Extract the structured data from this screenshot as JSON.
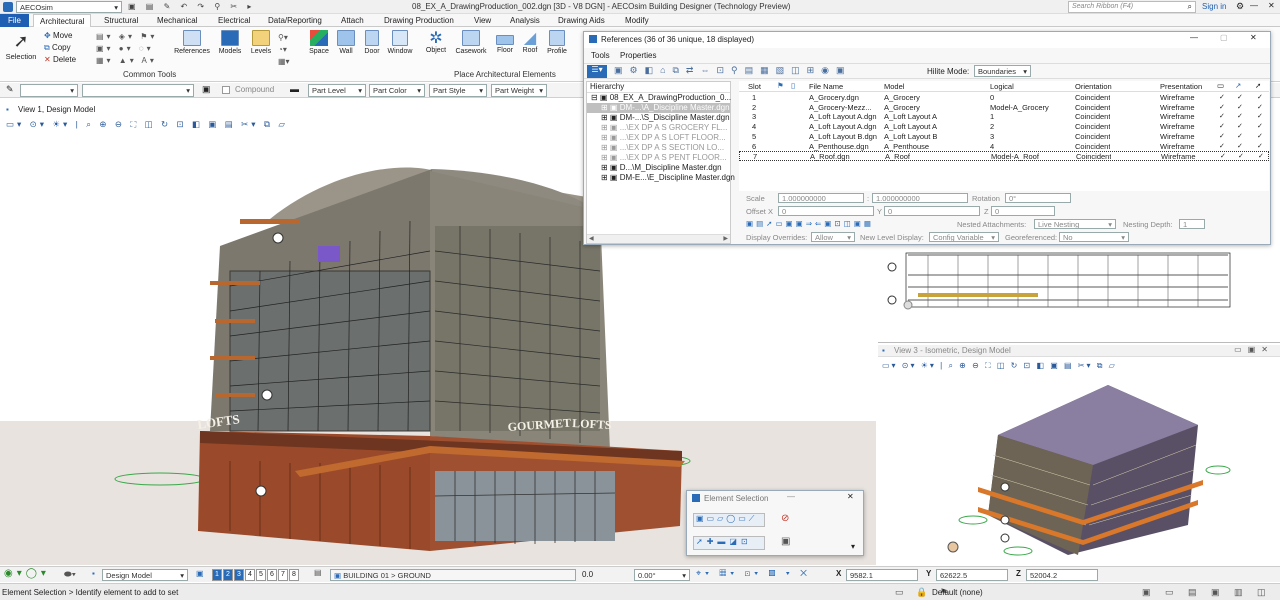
{
  "titlebar": {
    "app_selector": "AECOsim",
    "title": "08_EX_A_DrawingProduction_002.dgn [3D - V8 DGN] - AECOsim Building Designer (Technology Preview)",
    "search_placeholder": "Search Ribbon (F4)",
    "signin": "Sign in"
  },
  "ribbon": {
    "tabs": [
      "File",
      "Architectural",
      "Structural",
      "Mechanical",
      "Electrical",
      "Data/Reporting",
      "Attach",
      "Drawing Production",
      "View",
      "Analysis",
      "Drawing Aids",
      "Modify"
    ],
    "active_tab": "Architectural",
    "common_tools": {
      "selection": "Selection",
      "move": "Move",
      "copy": "Copy",
      "delete": "Delete",
      "group_label": "Common Tools"
    },
    "place_tools": [
      "References",
      "Models",
      "Levels",
      "Space",
      "Wall",
      "Door",
      "Window",
      "Object",
      "Casework",
      "Floor",
      "Roof",
      "Profile"
    ],
    "place_group_label": "Place Architectural Elements",
    "attr_compound": "Compound",
    "attr_part_level": "Part Level",
    "attr_part_color": "Part Color",
    "attr_part_style": "Part Style",
    "attr_part_weight": "Part Weight"
  },
  "view1": {
    "title": "View 1, Design Model"
  },
  "view3": {
    "title": "View 3 - Isometric, Design Model"
  },
  "references": {
    "title": "References (36 of 36 unique, 18 displayed)",
    "menu": [
      "Tools",
      "Properties"
    ],
    "hilite_label": "Hilite Mode:",
    "hilite_value": "Boundaries",
    "hierarchy_header": "Hierarchy",
    "hierarchy": [
      "08_EX_A_DrawingProduction_0...",
      "DM-...\\A_Discipline Master.dgn",
      "DM-...\\S_Discipline Master.dgn",
      "...\\EX DP A S GROCERY FL...",
      "...\\EX DP A S LOFT FLOOR...",
      "...\\EX DP A S SECTION LO...",
      "...\\EX DP A S PENT FLOOR...",
      "D...\\M_Discipline Master.dgn",
      "DM-E...\\E_Discipline Master.dgn"
    ],
    "columns": [
      "Slot",
      "File Name",
      "Model",
      "Logical",
      "Orientation",
      "Presentation"
    ],
    "rows": [
      {
        "slot": "1",
        "file": "A_Grocery.dgn",
        "model": "A_Grocery",
        "logical": "0",
        "orientation": "Coincident",
        "presentation": "Wireframe"
      },
      {
        "slot": "2",
        "file": "A_Grocery-Mezz...",
        "model": "A_Grocery",
        "logical": "Model-A_Grocery",
        "orientation": "Coincident",
        "presentation": "Wireframe"
      },
      {
        "slot": "3",
        "file": "A_Loft Layout A.dgn",
        "model": "A_Loft Layout A",
        "logical": "1",
        "orientation": "Coincident",
        "presentation": "Wireframe"
      },
      {
        "slot": "4",
        "file": "A_Loft Layout A.dgn",
        "model": "A_Loft Layout A",
        "logical": "2",
        "orientation": "Coincident",
        "presentation": "Wireframe"
      },
      {
        "slot": "5",
        "file": "A_Loft Layout B.dgn",
        "model": "A_Loft Layout B",
        "logical": "3",
        "orientation": "Coincident",
        "presentation": "Wireframe"
      },
      {
        "slot": "6",
        "file": "A_Penthouse.dgn",
        "model": "A_Penthouse",
        "logical": "4",
        "orientation": "Coincident",
        "presentation": "Wireframe"
      },
      {
        "slot": "7",
        "file": "A_Roof.dgn",
        "model": "A_Roof",
        "logical": "Model-A_Roof",
        "orientation": "Coincident",
        "presentation": "Wireframe"
      }
    ],
    "scale_label": "Scale",
    "scale_1": "1.000000000",
    "scale_2": "1.000000000",
    "rotation_label": "Rotation",
    "rotation_value": "0°",
    "offset_label": "Offset X",
    "offset_x": "0",
    "offset_y_label": "Y",
    "offset_y": "0",
    "offset_z_label": "Z",
    "offset_z": "0",
    "nested_label": "Nested Attachments:",
    "nested_value": "Live Nesting",
    "depth_label": "Nesting Depth:",
    "depth_value": "1",
    "display_overrides_label": "Display Overrides:",
    "display_overrides_value": "Allow",
    "new_level_label": "New Level Display:",
    "new_level_value": "Config Variable",
    "georef_label": "Georeferenced:",
    "georef_value": "No"
  },
  "element_selection": {
    "title": "Element Selection"
  },
  "building_signs": {
    "lofts_left": "LOFTS",
    "gourmet": "GOURMET",
    "lofts_right": "LOFTS"
  },
  "statusbar": {
    "model": "Design Model",
    "views": [
      "1",
      "2",
      "3",
      "4",
      "5",
      "6",
      "7",
      "8"
    ],
    "level_path": "BUILDING 01 > GROUND",
    "val1": "0.0",
    "angle": "0.00°",
    "x_label": "X",
    "x_value": "9582.1",
    "y_label": "Y",
    "y_value": "62622.5",
    "z_label": "Z",
    "z_value": "52004.2",
    "prompt": "Element Selection > Identify element to add to set",
    "default_level": "Default (none)"
  },
  "colors": {
    "accent": "#1e5fb4",
    "facade_brick": "#9a4a2a",
    "facade_grey": "#8e8a80"
  }
}
